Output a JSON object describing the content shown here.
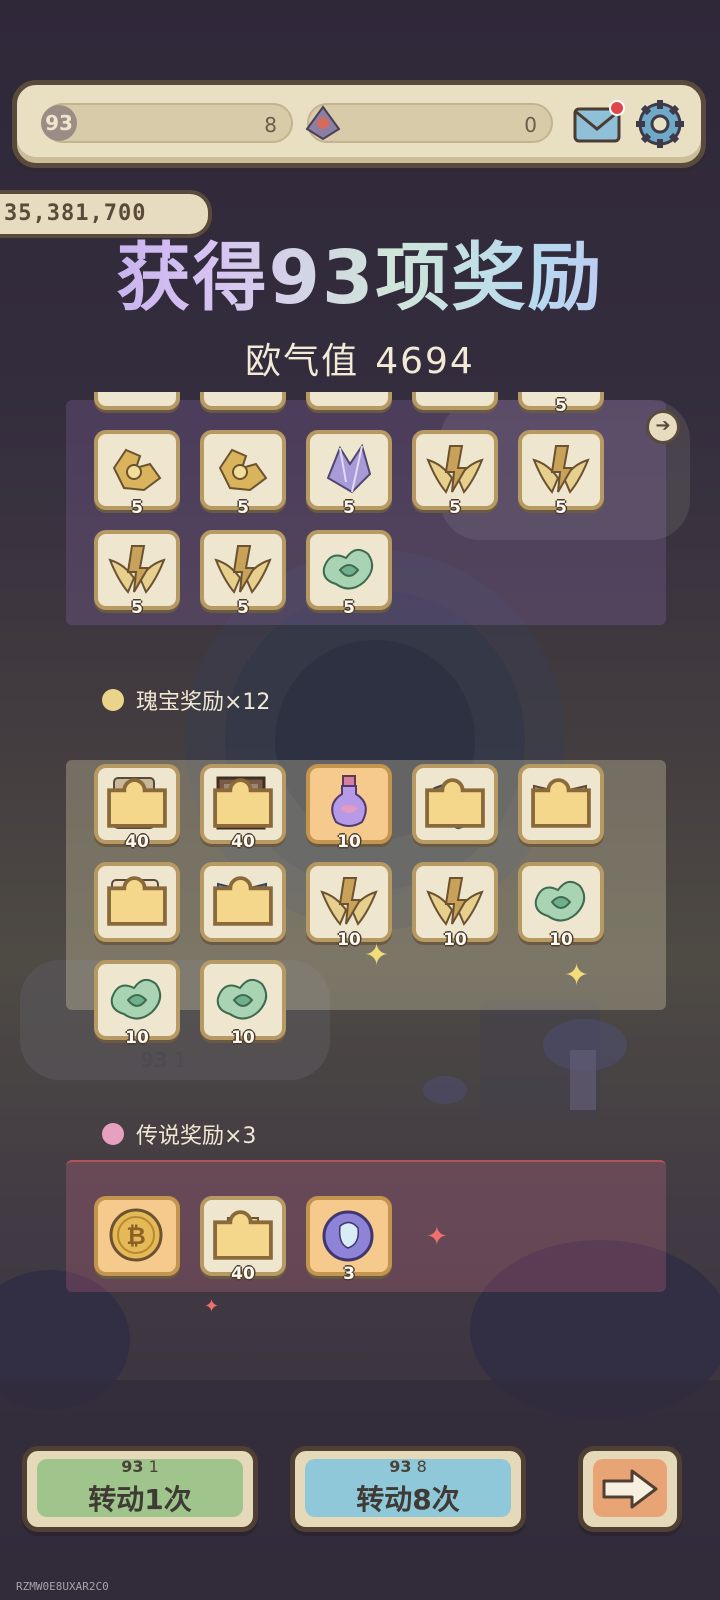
{
  "topbar": {
    "scroll_count": "8",
    "ticket_count": "0",
    "mail_has_notification": true
  },
  "gold_display": "35,381,700",
  "title": "获得93项奖励",
  "luck": {
    "label": "欧气值",
    "value": "4694"
  },
  "sections": {
    "treasure": {
      "label": "瑰宝奖励×12"
    },
    "legendary": {
      "label": "传说奖励×3"
    }
  },
  "rewards": {
    "partial_top_qty": "5",
    "row1": [
      {
        "icon": "golden-gauntlet-icon",
        "qty": "5"
      },
      {
        "icon": "golden-gauntlet-icon",
        "qty": "5"
      },
      {
        "icon": "crystal-shard-icon",
        "qty": "5"
      },
      {
        "icon": "golden-wings-icon",
        "qty": "5"
      },
      {
        "icon": "golden-wings-icon",
        "qty": "5"
      }
    ],
    "row2": [
      {
        "icon": "golden-wings-icon",
        "qty": "5"
      },
      {
        "icon": "golden-wings-icon",
        "qty": "5"
      },
      {
        "icon": "jade-bird-icon",
        "qty": "5"
      }
    ],
    "treasure_row1": [
      {
        "icon": "stone-tablet-icon",
        "qty": "40"
      },
      {
        "icon": "painting-icon",
        "qty": "40"
      },
      {
        "icon": "potion-flask-icon",
        "qty": "10"
      },
      {
        "icon": "hammer-tool-icon",
        "qty": ""
      },
      {
        "icon": "open-book-icon",
        "qty": ""
      }
    ],
    "treasure_row2": [
      {
        "icon": "scroll-gate-icon",
        "qty": ""
      },
      {
        "icon": "blue-tome-icon",
        "qty": ""
      },
      {
        "icon": "golden-wings-icon",
        "qty": "10"
      },
      {
        "icon": "golden-wings-icon",
        "qty": "10"
      },
      {
        "icon": "jade-bird-icon",
        "qty": "10"
      }
    ],
    "treasure_row3": [
      {
        "icon": "jade-bird-icon",
        "qty": "10"
      },
      {
        "icon": "jade-bird-icon",
        "qty": "10"
      }
    ],
    "legendary_row": [
      {
        "icon": "gold-coin-icon",
        "qty": ""
      },
      {
        "icon": "gold-bars-icon",
        "qty": "40"
      },
      {
        "icon": "spirit-orb-icon",
        "qty": "3"
      }
    ]
  },
  "background_cost": "1",
  "buttons": {
    "spin1": {
      "cost": "1",
      "label": "转动1次"
    },
    "spin8": {
      "cost": "8",
      "label": "转动8次"
    }
  },
  "footer_id": "RZMW0E8UXAR2C0"
}
